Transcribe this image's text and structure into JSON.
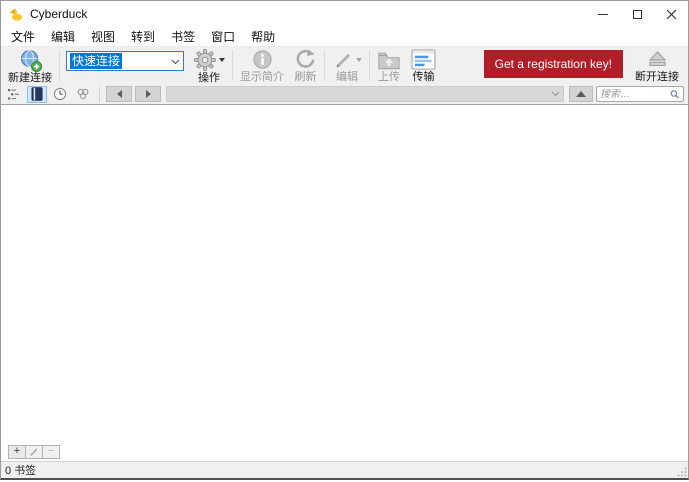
{
  "window": {
    "title": "Cyberduck"
  },
  "menu": {
    "items": [
      "文件",
      "编辑",
      "视图",
      "转到",
      "书签",
      "窗口",
      "帮助"
    ]
  },
  "toolbar": {
    "new_connection_label": "新建连接",
    "quick_connect_value": "快速连接",
    "action_label": "操作",
    "info_label": "显示简介",
    "refresh_label": "刷新",
    "edit_label": "编辑",
    "upload_label": "上传",
    "transfers_label": "传输",
    "registration_label": "Get a registration key!",
    "disconnect_label": "断开连接"
  },
  "navbar": {
    "search_placeholder": "搜索…"
  },
  "bookmark_bar": {
    "add_label": "+",
    "remove_label": "−"
  },
  "status_bar": {
    "text": "0 书签"
  },
  "colors": {
    "registration_red": "#b01e28",
    "selection_blue": "#0078d7",
    "view_selected_bg": "#cfe8ff",
    "view_selected_border": "#86c2ef"
  }
}
